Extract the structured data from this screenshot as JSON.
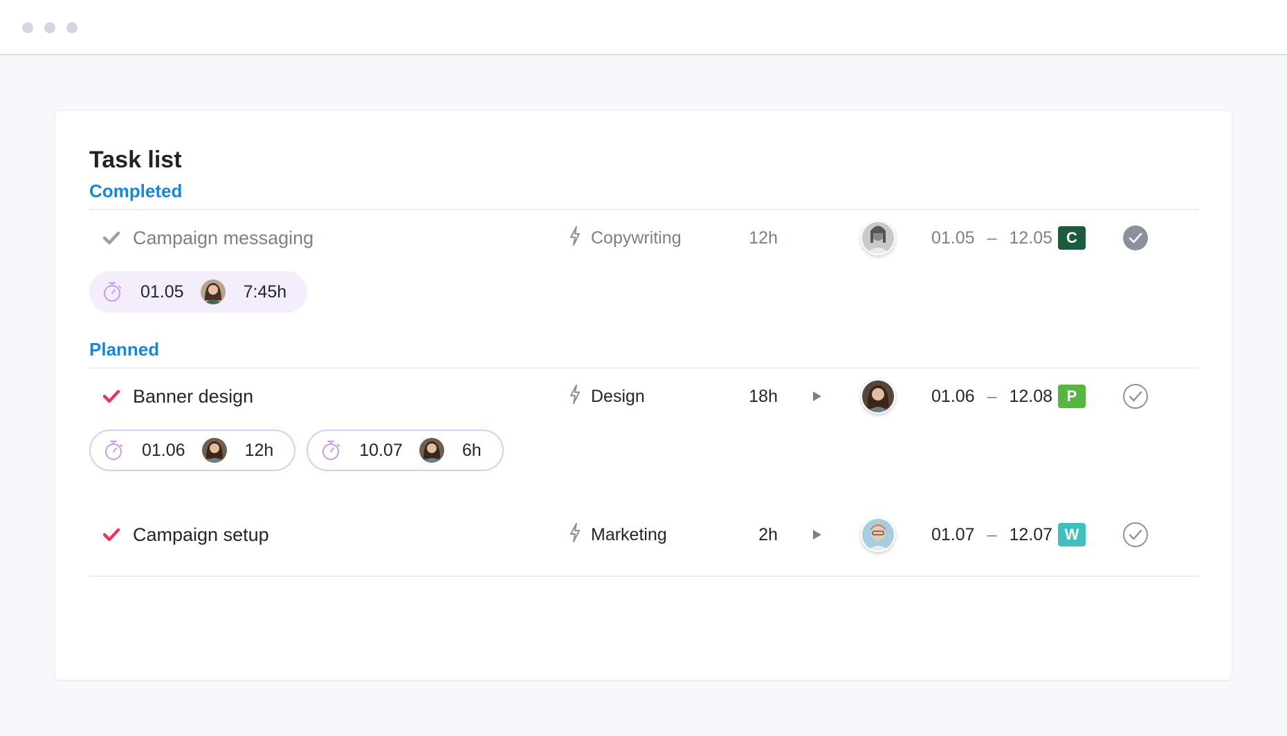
{
  "title": "Task list",
  "colors": {
    "section_label": "#1787d6",
    "check_done": "#9aa1ac",
    "check_active": "#e23a57",
    "timer_purple": "#c49be8",
    "badge_c": "#1c5b3e",
    "badge_p": "#58b542",
    "badge_w": "#3fbfbd"
  },
  "sections": [
    {
      "label": "Completed",
      "tasks": [
        {
          "name": "Campaign messaging",
          "category": "Copywriting",
          "hours": "12h",
          "has_play": false,
          "date_start": "01.05",
          "date_sep": "–",
          "date_end": "12.05",
          "badge": "C",
          "status": "completed",
          "time_entries": [
            {
              "date": "01.05",
              "duration": "7:45h"
            }
          ]
        }
      ]
    },
    {
      "label": "Planned",
      "tasks": [
        {
          "name": "Banner design",
          "category": "Design",
          "hours": "18h",
          "has_play": true,
          "date_start": "01.06",
          "date_sep": "–",
          "date_end": "12.08",
          "badge": "P",
          "status": "open",
          "time_entries": [
            {
              "date": "01.06",
              "duration": "12h"
            },
            {
              "date": "10.07",
              "duration": "6h"
            }
          ]
        },
        {
          "name": "Campaign setup",
          "category": "Marketing",
          "hours": "2h",
          "has_play": true,
          "date_start": "01.07",
          "date_sep": "–",
          "date_end": "12.07",
          "badge": "W",
          "status": "open",
          "time_entries": []
        }
      ]
    }
  ]
}
